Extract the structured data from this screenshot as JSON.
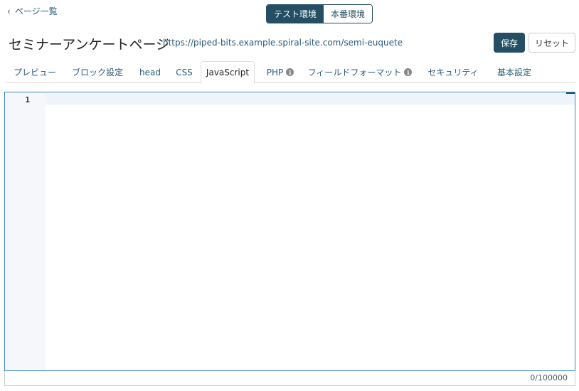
{
  "nav": {
    "back_icon": "chevron-left-icon",
    "back_label": "ページ一覧"
  },
  "env": {
    "test_label": "テスト環境",
    "prod_label": "本番環境",
    "selected": "テスト環境"
  },
  "header": {
    "title": "セミナーアンケートページ",
    "url": "https://piped-bits.example.spiral-site.com/semi-euquete",
    "save_label": "保存",
    "reset_label": "リセット"
  },
  "tabs": [
    {
      "label": "プレビュー",
      "info": false
    },
    {
      "label": "ブロック設定",
      "info": false
    },
    {
      "label": "head",
      "info": false
    },
    {
      "label": "CSS",
      "info": false
    },
    {
      "label": "JavaScript",
      "info": false,
      "active": true
    },
    {
      "label": "PHP",
      "info": true
    },
    {
      "label": "フィールドフォーマット",
      "info": true
    },
    {
      "label": "セキュリティ",
      "info": false
    },
    {
      "label": "基本設定",
      "info": false
    }
  ],
  "editor": {
    "line_numbers": [
      "1"
    ],
    "content": ""
  },
  "counter": "0/100000",
  "colors": {
    "primary": "#234e63",
    "link": "#2a5b78",
    "editor_border": "#3a89c9"
  }
}
